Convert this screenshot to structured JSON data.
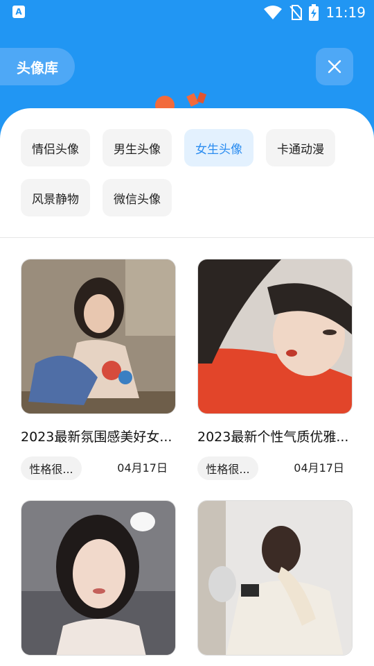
{
  "status": {
    "time": "11:19",
    "app_icon": "A"
  },
  "header": {
    "title": "头像库",
    "close_icon": "close-icon"
  },
  "categories": [
    {
      "label": "情侣头像",
      "active": false
    },
    {
      "label": "男生头像",
      "active": false
    },
    {
      "label": "女生头像",
      "active": true
    },
    {
      "label": "卡通动漫",
      "active": false
    },
    {
      "label": "风景静物",
      "active": false
    },
    {
      "label": "微信头像",
      "active": false
    }
  ],
  "cards": [
    {
      "title": "2023最新氛围感美好女...",
      "tag": "性格很...",
      "date": "04月17日"
    },
    {
      "title": "2023最新个性气质优雅...",
      "tag": "性格很...",
      "date": "04月17日"
    },
    {
      "title": "",
      "tag": "",
      "date": ""
    },
    {
      "title": "",
      "tag": "",
      "date": ""
    }
  ],
  "colors": {
    "primary": "#2196F3",
    "chip_active_bg": "#E3F1FE",
    "chip_active_text": "#2A8CF0"
  }
}
